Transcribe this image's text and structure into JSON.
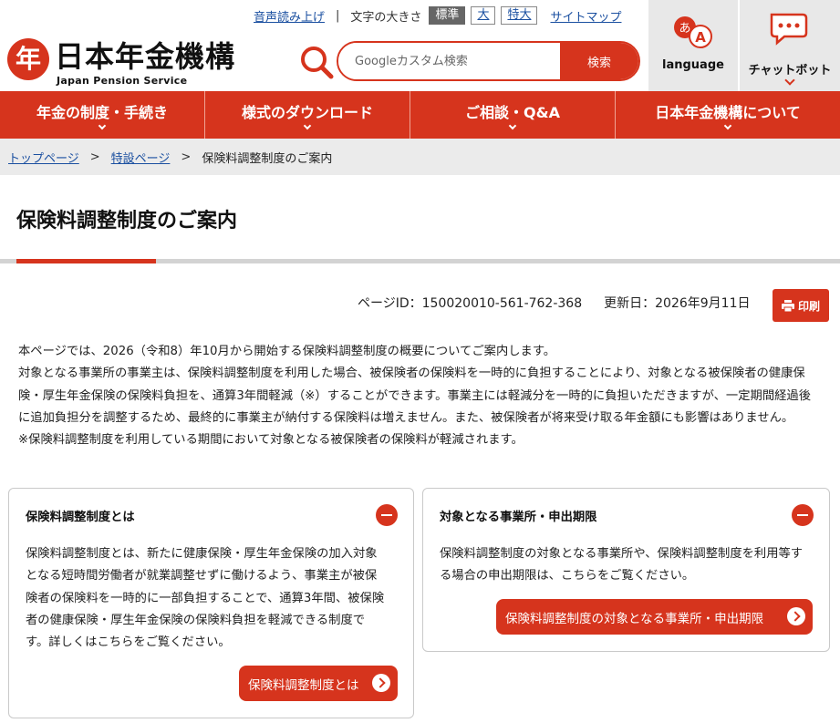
{
  "header": {
    "util_links": {
      "read_aloud": "音声読み上げ",
      "sitemap": "サイトマップ"
    },
    "separator": "|",
    "font_size": {
      "label": "文字の大きさ",
      "options": [
        "標準",
        "大",
        "特大"
      ],
      "selected": "標準"
    },
    "logo": {
      "mark": "年",
      "jp": "日本年金機構",
      "en": "Japan Pension Service"
    },
    "search": {
      "placeholder": "Googleカスタム検索",
      "button": "検索"
    },
    "language_label": "language",
    "chatbot_label": "チャットボット"
  },
  "nav": {
    "items": [
      "年金の制度・手続き",
      "様式のダウンロード",
      "ご相談・Q&A",
      "日本年金機構について"
    ]
  },
  "breadcrumb": {
    "items": [
      "トップページ",
      "特設ページ"
    ],
    "current": "保険料調整制度のご案内",
    "separator": ">"
  },
  "page": {
    "title": "保険料調整制度のご案内",
    "page_id": "ページID：150020010-561-762-368",
    "updated": "更新日：2026年9月11日",
    "print_label": "印刷",
    "intro": [
      "本ページでは、2026（令和8）年10月から開始する保険料調整制度の概要についてご案内します。",
      "対象となる事業所の事業主は、保険料調整制度を利用した場合、被保険者の保険料を一時的に負担することにより、対象となる被保険者の健康保険・厚生年金保険の保険料負担を、通算3年間軽減（※）することができます。事業主には軽減分を一時的に負担いただきますが、一定期間経過後に追加負担分を調整するため、最終的に事業主が納付する保険料は増えません。また、被保険者が将来受け取る年金額にも影響はありません。",
      "※保険料調整制度を利用している期間において対象となる被保険者の保険料が軽減されます。"
    ]
  },
  "cards": [
    {
      "title": "保険料調整制度とは",
      "body": "保険料調整制度とは、新たに健康保険・厚生年金保険の加入対象となる短時間労働者が就業調整せずに働けるよう、事業主が被保険者の保険料を一時的に一部負担することで、通算3年間、被保険者の健康保険・厚生年金保険の保険料負担を軽減できる制度です。詳しくはこちらをご覧ください。",
      "button": "保険料調整制度とは"
    },
    {
      "title": "対象となる事業所・申出期限",
      "body": "保険料調整制度の対象となる事業所や、保険料調整制度を利用等する場合の申出期限は、こちらをご覧ください。",
      "button": "保険料調整制度の対象となる事業所・申出期限"
    }
  ],
  "colors": {
    "brand_red": "#d6341d",
    "link_blue": "#1a4fa0",
    "gray_bg": "#ebebeb"
  }
}
